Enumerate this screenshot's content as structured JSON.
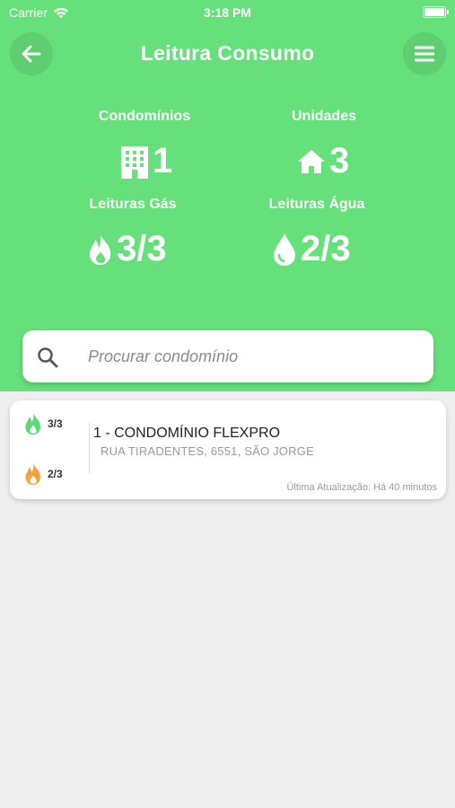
{
  "status": {
    "carrier": "Carrier",
    "time": "3:18 PM"
  },
  "header": {
    "title": "Leitura Consumo"
  },
  "stats": [
    {
      "label": "Condomínios",
      "value": "1",
      "icon": "building-icon"
    },
    {
      "label": "Unidades",
      "value": "3",
      "icon": "home-icon"
    },
    {
      "label": "Leituras Gás",
      "value": "3/3",
      "icon": "fire-icon"
    },
    {
      "label": "Leituras Água",
      "value": "2/3",
      "icon": "water-drop-icon"
    }
  ],
  "search": {
    "placeholder": "Procurar condomínio"
  },
  "list": [
    {
      "gas": "3/3",
      "water": "2/3",
      "title": "1 - CONDOMÍNIO FLEXPRO",
      "address": "RUA TIRADENTES, 6551, SÃO JORGE",
      "updated": "Última Atualização: Há 40 minutos"
    }
  ],
  "colors": {
    "header": "#66e07a",
    "gas_icon": "#5fd873",
    "water_icon": "#f4a23c",
    "background": "#efefef"
  }
}
